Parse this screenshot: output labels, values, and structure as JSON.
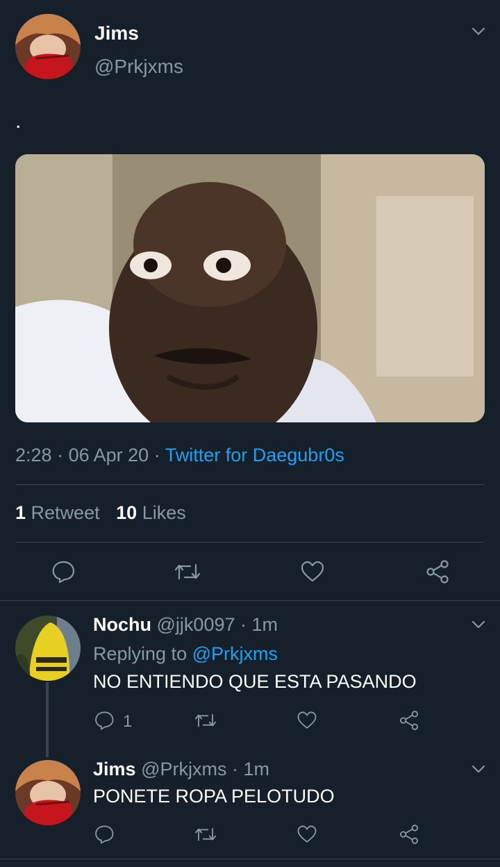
{
  "tweet": {
    "author": {
      "name": "Jims",
      "handle": "@Prkjxms"
    },
    "text": ".",
    "time": "2:28",
    "date": "06 Apr 20",
    "source": "Twitter for Daegubr0s",
    "retweet_count": "1",
    "retweet_label": "Retweet",
    "like_count": "10",
    "like_label": "Likes"
  },
  "replies": [
    {
      "name": "Nochu",
      "handle": "@jjk0097",
      "time": "1m",
      "replying_prefix": "Replying to",
      "replying_to": "@Prkjxms",
      "text": "NO ENTIENDO QUE ESTA PASANDO",
      "reply_count": "1"
    },
    {
      "name": "Jims",
      "handle": "@Prkjxms",
      "time": "1m",
      "text": "PONETE ROPA PELOTUDO"
    }
  ],
  "separator": "·",
  "colors": {
    "background": "#15202b",
    "muted": "#8899a6",
    "accent": "#1da1f2",
    "divider": "#38444d"
  },
  "icons": [
    "chevron-down-icon",
    "reply-icon",
    "retweet-icon",
    "like-icon",
    "share-icon"
  ]
}
